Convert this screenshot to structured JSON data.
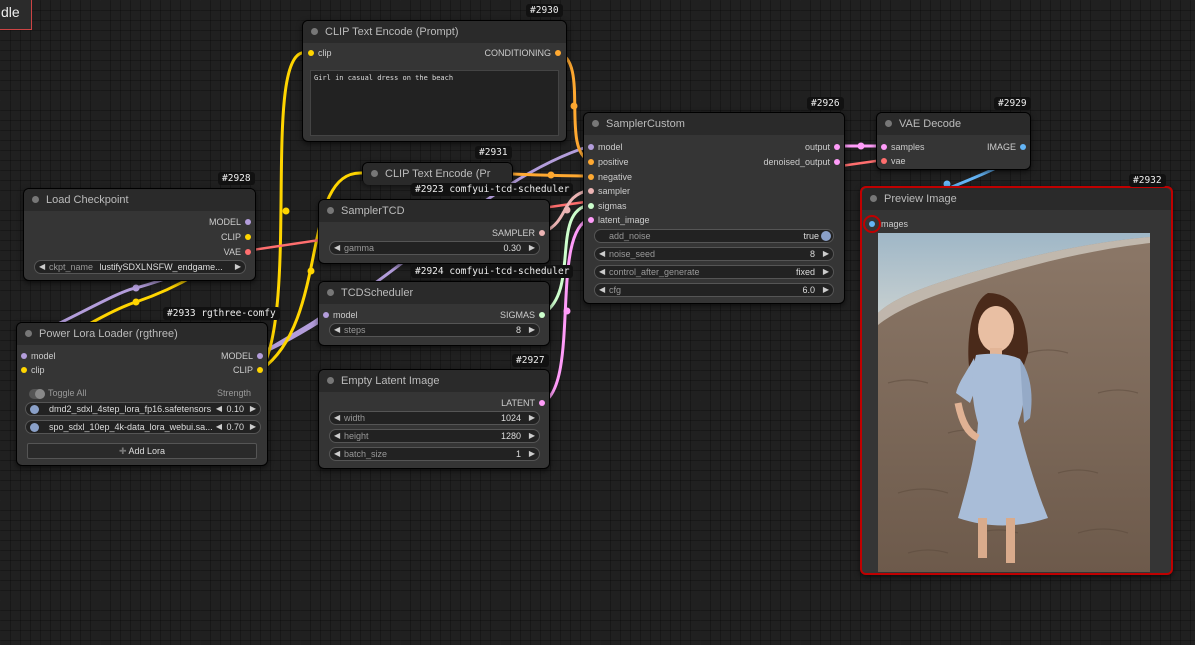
{
  "corner_text": "dle",
  "nodes": {
    "clip_prompt": {
      "id": "#2930",
      "title": "CLIP Text Encode (Prompt)",
      "in_clip": "clip",
      "out_conditioning": "CONDITIONING",
      "text": "Girl in casual dress on the beach"
    },
    "sampler_custom": {
      "id": "#2926",
      "title": "SamplerCustom",
      "in_model": "model",
      "in_positive": "positive",
      "in_negative": "negative",
      "in_sampler": "sampler",
      "in_sigmas": "sigmas",
      "in_latent": "latent_image",
      "out_output": "output",
      "out_denoised": "denoised_output",
      "w_add_noise": "add_noise",
      "w_add_noise_val": "true",
      "w_noise_seed": "noise_seed",
      "w_noise_seed_val": "8",
      "w_cag": "control_after_generate",
      "w_cag_val": "fixed",
      "w_cfg": "cfg",
      "w_cfg_val": "6.0"
    },
    "vae_decode": {
      "id": "#2929",
      "title": "VAE Decode",
      "in_samples": "samples",
      "in_vae": "vae",
      "out_image": "IMAGE"
    },
    "preview": {
      "id": "#2932",
      "title": "Preview Image",
      "in_images": "images"
    },
    "clip2": {
      "id": "#2931",
      "title": "CLIP Text Encode (Pr"
    },
    "load_ckpt": {
      "id": "#2928",
      "title": "Load Checkpoint",
      "out_model": "MODEL",
      "out_clip": "CLIP",
      "out_vae": "VAE",
      "w_ckpt": "ckpt_name",
      "w_ckpt_val": "lustifySDXLNSFW_endgame..."
    },
    "sampler_tcd": {
      "id": "#2923 comfyui-tcd-scheduler",
      "title": "SamplerTCD",
      "out_sampler": "SAMPLER",
      "w_gamma": "gamma",
      "w_gamma_val": "0.30"
    },
    "tcd_sched": {
      "id": "#2924 comfyui-tcd-scheduler",
      "title": "TCDScheduler",
      "in_model": "model",
      "out_sigmas": "SIGMAS",
      "w_steps": "steps",
      "w_steps_val": "8"
    },
    "empty_latent": {
      "id": "#2927",
      "title": "Empty Latent Image",
      "out_latent": "LATENT",
      "w_width": "width",
      "w_width_val": "1024",
      "w_height": "height",
      "w_height_val": "1280",
      "w_batch": "batch_size",
      "w_batch_val": "1"
    },
    "lora": {
      "id": "#2933 rgthree-comfy",
      "title": "Power Lora Loader (rgthree)",
      "in_model": "model",
      "in_clip": "clip",
      "out_model": "MODEL",
      "out_clip": "CLIP",
      "toggle_all": "Toggle All",
      "strength": "Strength",
      "lora1_name": "dmd2_sdxl_4step_lora_fp16.safetensors",
      "lora1_val": "0.10",
      "lora2_name": "spo_sdxl_10ep_4k-data_lora_webui.sa...",
      "lora2_val": "0.70",
      "add_lora": "Add Lora",
      "add_icon": "plus-icon"
    }
  },
  "colors": {
    "model": "#b39ddb",
    "clip": "#ffd500",
    "vae": "#ff6e6e",
    "conditioning": "#ffa931",
    "latent": "#ff9cf9",
    "image": "#64b5f6",
    "sampler": "#ecb4b4",
    "sigmas": "#cdffcd",
    "selected": "#c00000"
  }
}
